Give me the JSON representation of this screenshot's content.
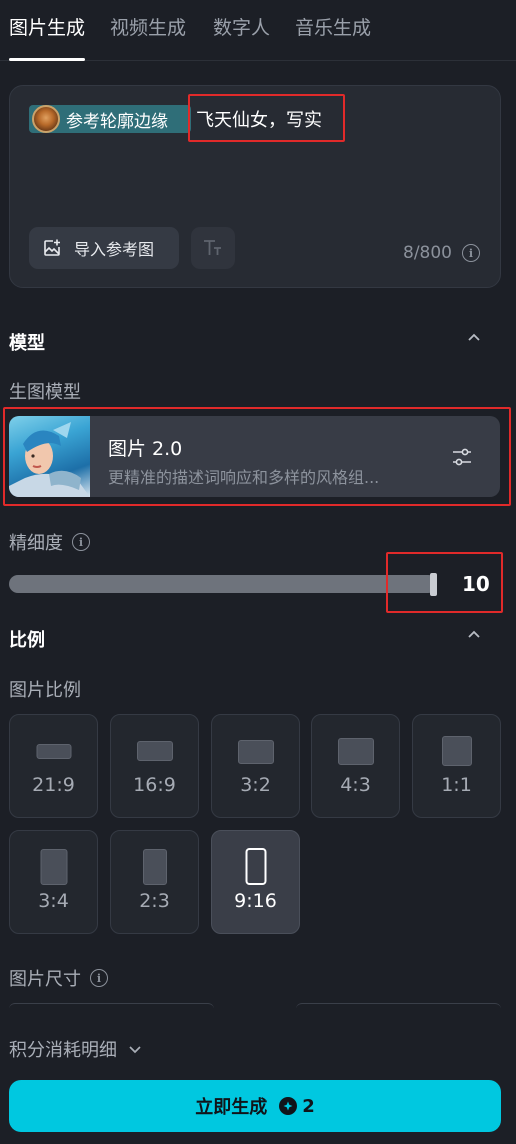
{
  "tabs": [
    {
      "label": "图片生成",
      "active": true
    },
    {
      "label": "视频生成",
      "active": false
    },
    {
      "label": "数字人",
      "active": false
    },
    {
      "label": "音乐生成",
      "active": false
    }
  ],
  "prompt": {
    "reference_chip": "参考轮廓边缘",
    "text": "飞天仙女，写实",
    "import_button": "导入参考图",
    "counter": "8/800"
  },
  "model_section": {
    "title": "模型",
    "sub_label": "生图模型",
    "model_name": "图片 2.0",
    "model_desc": "更精准的描述词响应和多样的风格组..."
  },
  "detail": {
    "label": "精细度",
    "value": "10",
    "level": 1.0
  },
  "ratio_section": {
    "title": "比例",
    "sub_label": "图片比例",
    "options": [
      {
        "label": "21:9",
        "selected": false
      },
      {
        "label": "16:9",
        "selected": false
      },
      {
        "label": "3:2",
        "selected": false
      },
      {
        "label": "4:3",
        "selected": false
      },
      {
        "label": "1:1",
        "selected": false
      },
      {
        "label": "3:4",
        "selected": false
      },
      {
        "label": "2:3",
        "selected": false
      },
      {
        "label": "9:16",
        "selected": true
      }
    ]
  },
  "size_section": {
    "sub_label": "图片尺寸"
  },
  "footer": {
    "points_label": "积分消耗明细",
    "generate_label": "立即生成",
    "cost": "2"
  },
  "colors": {
    "accent": "#00c8e0",
    "highlight_box": "#e12a2a",
    "chip_bg": "#2f6e78",
    "background": "#1c1f26"
  }
}
